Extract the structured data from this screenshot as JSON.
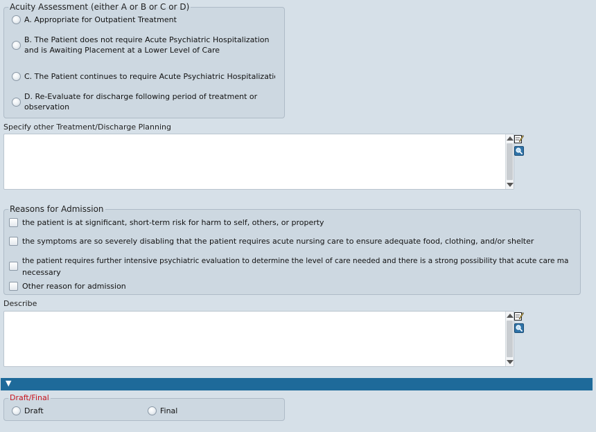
{
  "acuity": {
    "legend": "Acuity Assessment (either A or B or C or D)",
    "options": [
      "A. Appropriate for Outpatient Treatment",
      "B. The Patient does not require Acute Psychiatric Hospitalization",
      "and is Awaiting Placement at a Lower Level of Care",
      "C. The Patient continues to require Acute Psychiatric Hospitalizatic",
      "D. Re-Evaluate for discharge following period of treatment or",
      "observation"
    ]
  },
  "other_planning": {
    "label": "Specify other Treatment/Discharge Planning",
    "value": ""
  },
  "reasons": {
    "legend": "Reasons for Admission",
    "items": [
      "the patient is at significant, short-term risk for harm to self, others, or property",
      "the symptoms are so severely disabling that the patient requires acute nursing care to ensure adequate food, clothing, and/or shelter",
      "the patient requires further intensive psychiatric evaluation to determine the level of care needed and there is a strong possibility that acute care ma",
      "necessary",
      "Other reason for admission"
    ]
  },
  "describe": {
    "label": "Describe",
    "value": ""
  },
  "section_toggle": "▼",
  "draft_final": {
    "legend": "Draft/Final",
    "draft_label": "Draft",
    "final_label": "Final"
  },
  "colors": {
    "section_bar": "#1e6a9a",
    "legend_required": "#c8141e"
  }
}
